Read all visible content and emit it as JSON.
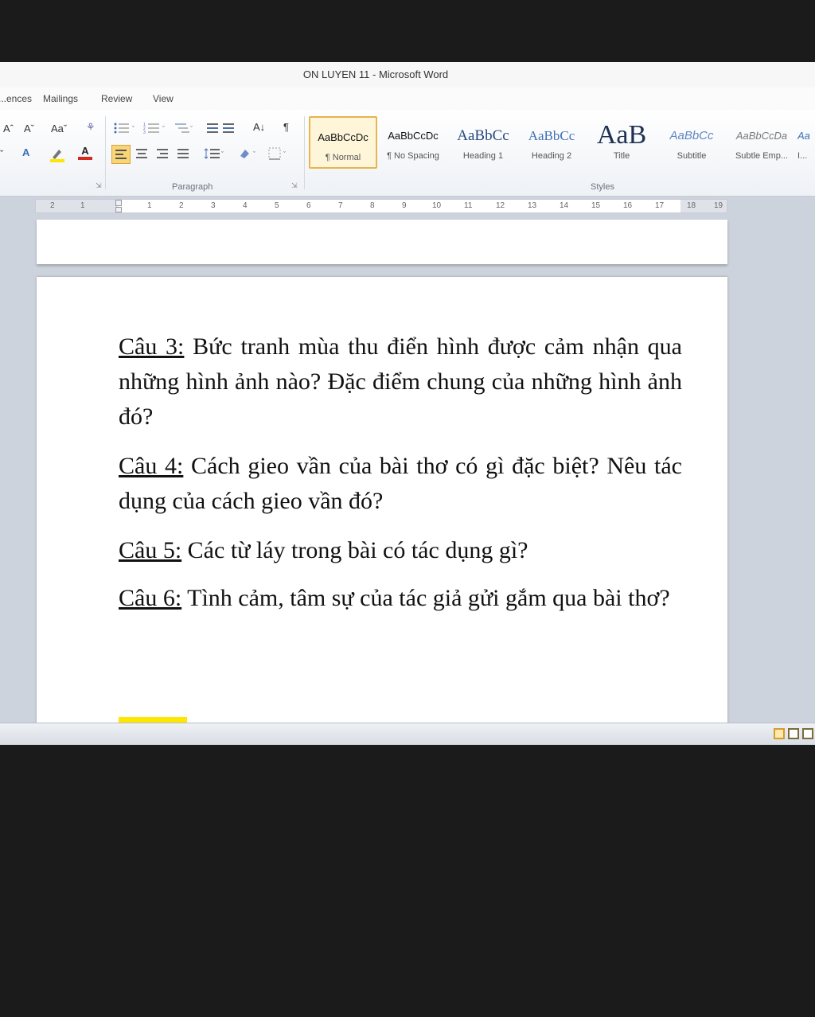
{
  "window": {
    "title": "ON LUYEN 11 - Microsoft Word"
  },
  "ribbon": {
    "tabs": [
      "...ences",
      "Mailings",
      "Review",
      "View"
    ],
    "font_group": {
      "grow": "Aˆ",
      "shrink": "Aˇ",
      "case": "Aaˇ",
      "clear": "⚘"
    },
    "paragraph_group": {
      "label": "Paragraph",
      "sort": "A↓",
      "pilcrow": "¶"
    },
    "styles_group": {
      "label": "Styles",
      "styles": [
        {
          "sample": "AaBbCcDc",
          "name": "¶ Normal"
        },
        {
          "sample": "AaBbCcDc",
          "name": "¶ No Spacing"
        },
        {
          "sample": "AaBbCc",
          "name": "Heading 1"
        },
        {
          "sample": "AaBbCc",
          "name": "Heading 2"
        },
        {
          "sample": "AaB",
          "name": "Title"
        },
        {
          "sample": "AaBbCc",
          "name": "Subtitle"
        },
        {
          "sample": "AaBbCcDa",
          "name": "Subtle Emp..."
        },
        {
          "sample": "Aa",
          "name": "I..."
        }
      ]
    }
  },
  "ruler": {
    "numbers": [
      "2",
      "1",
      "1",
      "2",
      "3",
      "4",
      "5",
      "6",
      "7",
      "8",
      "9",
      "10",
      "11",
      "12",
      "13",
      "14",
      "15",
      "16",
      "17",
      "18",
      "19"
    ]
  },
  "document": {
    "questions": [
      {
        "label": "Câu 3:",
        "text": " Bức tranh mùa thu điển hình được cảm nhận qua những hình ảnh nào? Đặc điểm chung của những hình ảnh đó?"
      },
      {
        "label": "Câu 4:",
        "text": " Cách gieo vần của bài thơ có gì đặc biệt? Nêu tác dụng của cách gieo vần đó?"
      },
      {
        "label": "Câu 5:",
        "text": " Các từ láy trong bài có tác dụng gì?"
      },
      {
        "label": "Câu 6:",
        "text": " Tình cảm, tâm sự của tác giả gửi gắm qua bài thơ?"
      }
    ]
  },
  "colors": {
    "highlight": "#ffe600",
    "active_style_border": "#e6b54d",
    "background": "#1b1b1b"
  }
}
